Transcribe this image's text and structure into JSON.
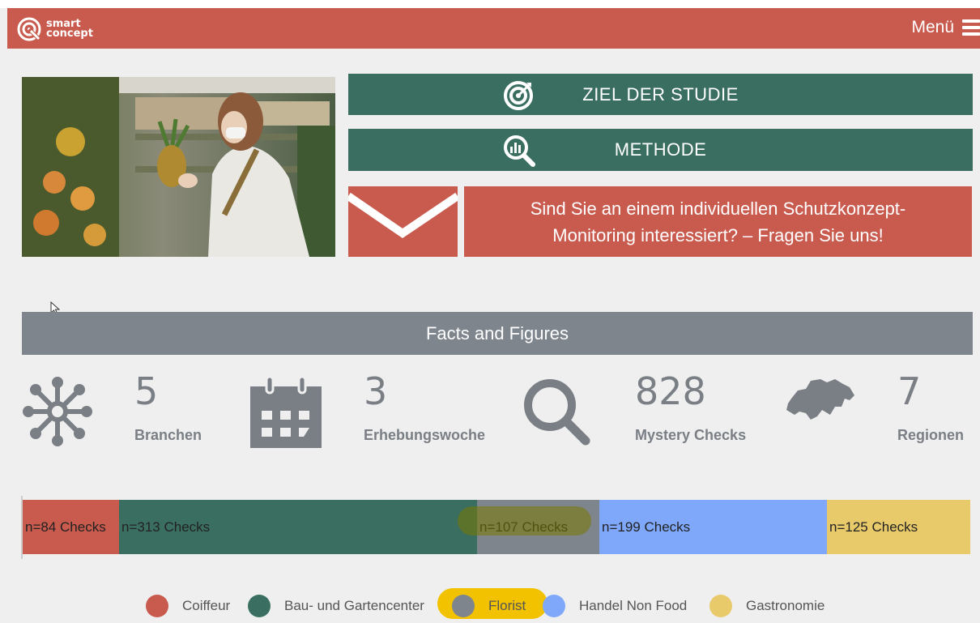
{
  "brand": {
    "line1": "smart",
    "line2": "concept"
  },
  "header": {
    "menu_label": "Menü"
  },
  "buttons": {
    "ziel": "ZIEL DER STUDIE",
    "methode": "METHODE",
    "contact": "Sind Sie an einem individuellen Schutzkonzept-Monitoring interessiert? – Fragen Sie uns!"
  },
  "facts": {
    "title": "Facts and Figures",
    "stats": [
      {
        "value": "5",
        "label": "Branchen",
        "icon": "network-icon"
      },
      {
        "value": "3",
        "label": "Erhebungswoche",
        "icon": "calendar-icon"
      },
      {
        "value": "828",
        "label": "Mystery Checks",
        "icon": "magnifier-icon"
      },
      {
        "value": "7",
        "label": "Regionen",
        "icon": "switzerland-map-icon"
      }
    ]
  },
  "distribution": {
    "segments": [
      {
        "label": "n=84 Checks",
        "checks": 84,
        "color": "#c95a4e"
      },
      {
        "label": "n=313 Checks",
        "checks": 313,
        "color": "#3a6e61"
      },
      {
        "label": "n=107 Checks",
        "checks": 107,
        "color": "#7e858d"
      },
      {
        "label": "n=199 Checks",
        "checks": 199,
        "color": "#7fa8fb"
      },
      {
        "label": "n=125 Checks",
        "checks": 125,
        "color": "#e8ca6b"
      }
    ],
    "legend": [
      {
        "label": "Coiffeur",
        "color": "#c95a4e"
      },
      {
        "label": "Bau- und Gartencenter",
        "color": "#3a6e61"
      },
      {
        "label": "Florist",
        "color": "#7e858d"
      },
      {
        "label": "Handel Non Food",
        "color": "#7fa8fb"
      },
      {
        "label": "Gastronomie",
        "color": "#e8ca6b"
      }
    ]
  },
  "colors": {
    "brand_red": "#c95a4e",
    "brand_green": "#3a6e61",
    "facts_gray": "#7e858d",
    "highlight_yellow": "#f2c200"
  }
}
